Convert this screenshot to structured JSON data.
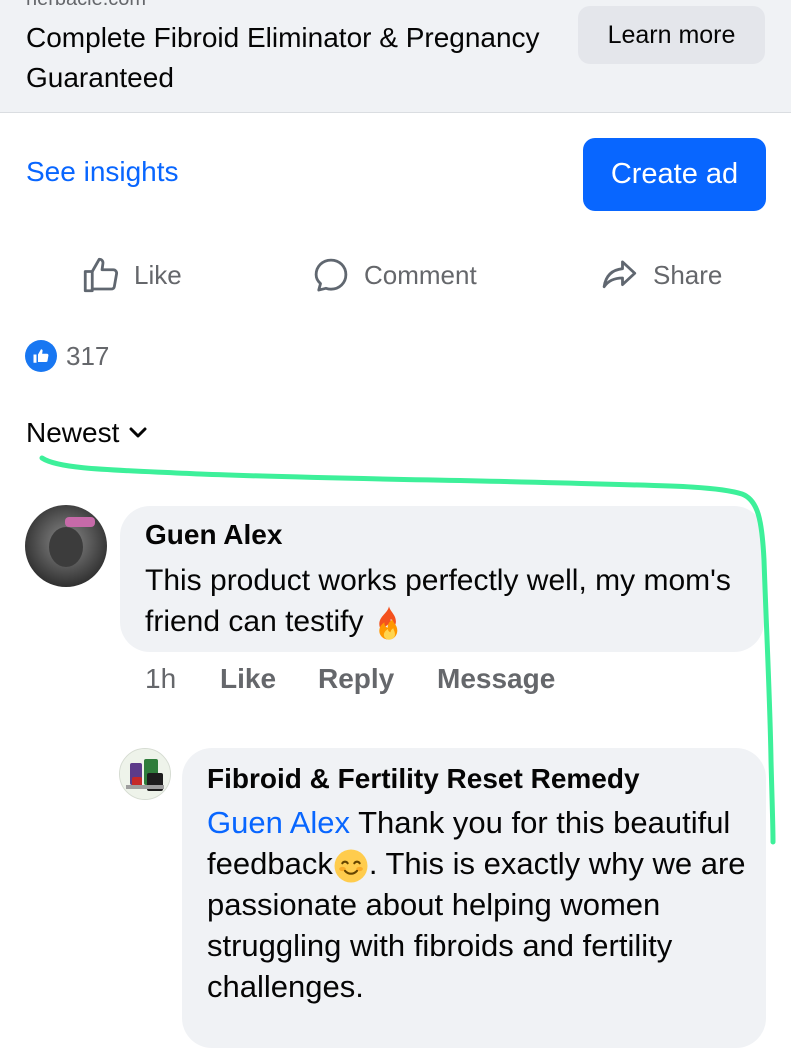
{
  "ad": {
    "domain": "herbacie.com",
    "headline": "Complete Fibroid Eliminator & Pregnancy Guaranteed",
    "cta_label": "Learn more"
  },
  "promo": {
    "insights_label": "See insights",
    "create_ad_label": "Create ad"
  },
  "actions": {
    "like_label": "Like",
    "comment_label": "Comment",
    "share_label": "Share"
  },
  "reactions": {
    "count": "317"
  },
  "sort": {
    "label": "Newest"
  },
  "comments": [
    {
      "author": "Guen Alex",
      "text": "This product works perfectly well, my mom's friend can testify",
      "emoji": "fire",
      "time": "1h",
      "like_label": "Like",
      "reply_label": "Reply",
      "message_label": "Message",
      "replies": [
        {
          "author": "Fibroid & Fertility Reset Remedy",
          "mention": "Guen Alex",
          "text_a": "Thank you for this beautiful feedback",
          "emoji": "smiling-face",
          "text_b": ". This is exactly why we are passionate about helping women struggling with fibroids and fertility challenges."
        }
      ]
    }
  ],
  "colors": {
    "accent": "#0866ff",
    "annotation": "#3df09a",
    "secondary_text": "#65676b",
    "bubble": "#f0f2f5"
  }
}
